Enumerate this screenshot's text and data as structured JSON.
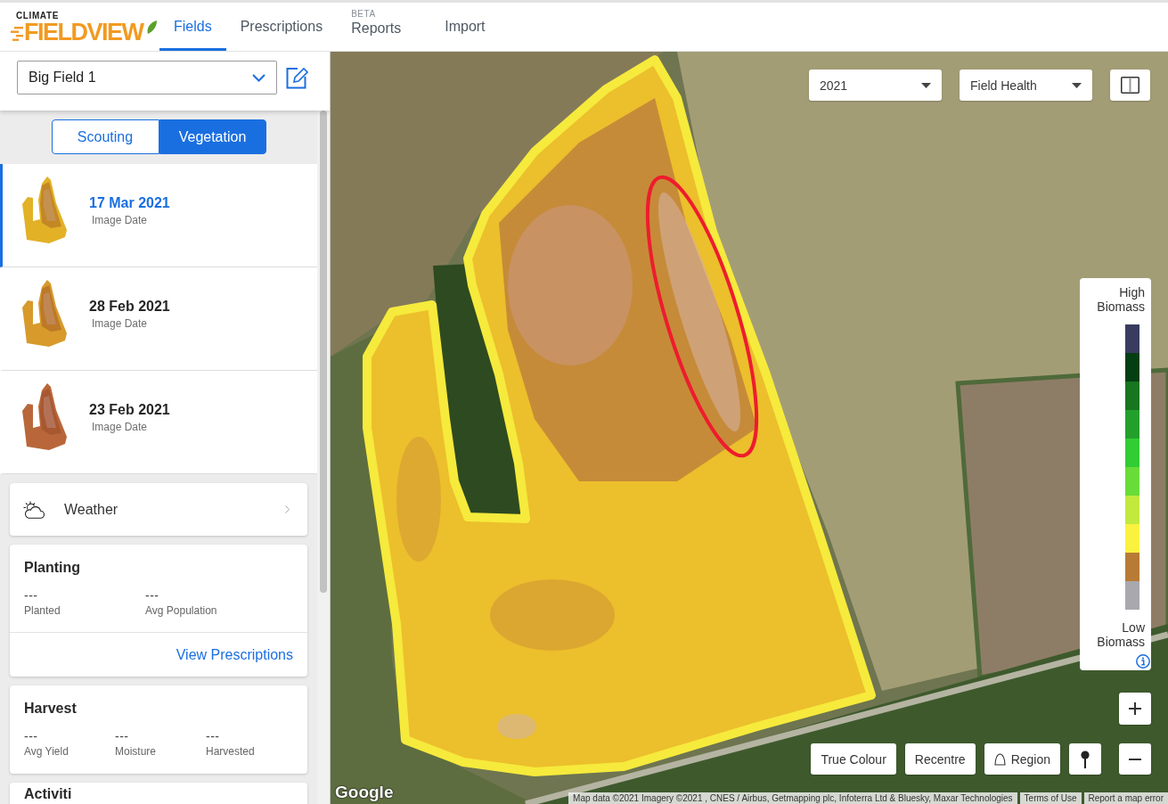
{
  "header": {
    "logo": {
      "small_text": "CLIMATE",
      "wordmark": "FIELDVIEW"
    },
    "nav_tabs": [
      {
        "label": "Fields",
        "selected": true
      },
      {
        "label": "Prescriptions",
        "selected": false
      },
      {
        "label": "Reports",
        "badge": "BETA",
        "selected": false
      },
      {
        "label": "Import",
        "selected": false
      }
    ]
  },
  "sidebar": {
    "field_select": {
      "value": "Big Field 1"
    },
    "view_toggle": [
      {
        "label": "Scouting",
        "selected": false
      },
      {
        "label": "Vegetation",
        "selected": true
      }
    ],
    "images": [
      {
        "date": "17 Mar 2021",
        "caption": "Image Date",
        "selected": true,
        "color": "#e2b126"
      },
      {
        "date": "28 Feb 2021",
        "caption": "Image Date",
        "selected": false,
        "color": "#d79a2b"
      },
      {
        "date": "23 Feb 2021",
        "caption": "Image Date",
        "selected": false,
        "color": "#b9673a"
      }
    ],
    "weather": {
      "title": "Weather"
    },
    "planting": {
      "title": "Planting",
      "stats": [
        {
          "value": "---",
          "label": "Planted"
        },
        {
          "value": "---",
          "label": "Avg Population"
        }
      ],
      "link": "View Prescriptions"
    },
    "harvest": {
      "title": "Harvest",
      "stats": [
        {
          "value": "---",
          "label": "Avg Yield"
        },
        {
          "value": "---",
          "label": "Moisture"
        },
        {
          "value": "---",
          "label": "Harvested"
        }
      ]
    },
    "activities": {
      "title": "Activiti"
    }
  },
  "map": {
    "year_select": {
      "value": "2021"
    },
    "layer_select": {
      "value": "Field Health"
    },
    "legend": {
      "high_label": "High Biomass",
      "low_label": "Low Biomass",
      "swatches": [
        {
          "color": "#393c5e"
        },
        {
          "color": "#033f13"
        },
        {
          "color": "#17761f"
        },
        {
          "color": "#23a02b"
        },
        {
          "color": "#32cc34"
        },
        {
          "color": "#68dc38"
        },
        {
          "color": "#c1e93e"
        },
        {
          "color": "#fbf13f"
        },
        {
          "color": "#b87b36"
        },
        {
          "color": "#a8a8ae"
        }
      ]
    },
    "buttons": [
      {
        "kind": "text",
        "label": "True Colour"
      },
      {
        "kind": "text",
        "label": "Recentre"
      },
      {
        "kind": "region",
        "label": "Region"
      },
      {
        "kind": "pin"
      }
    ],
    "logo": "Google",
    "attribution": {
      "text": "Map data ©2021 Imagery ©2021 , CNES / Airbus, Getmapping plc, Infoterra Ltd & Bluesky, Maxar Technologies",
      "links": [
        "Terms of Use",
        "Report a map error"
      ]
    }
  }
}
